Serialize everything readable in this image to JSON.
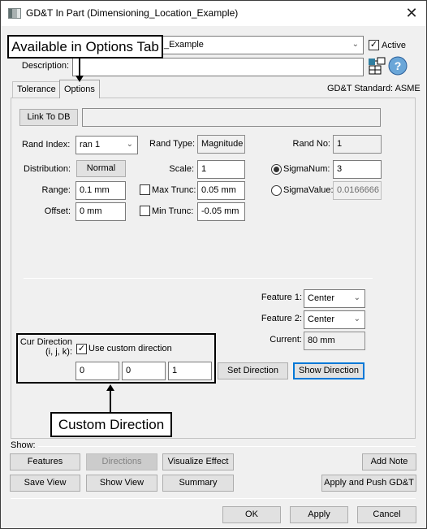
{
  "window": {
    "title": "GD&T In Part (Dimensioning_Location_Example)",
    "close_glyph": "✕"
  },
  "header": {
    "name_combo_value": "_Example",
    "active_label": "Active",
    "active_checked": true,
    "description_label": "Description:",
    "description_value": "",
    "gdt_standard": "GD&T Standard: ASME"
  },
  "tabs": [
    {
      "label": "Tolerance",
      "active": false
    },
    {
      "label": "Options",
      "active": true
    }
  ],
  "options": {
    "link_to_db_label": "Link To DB",
    "link_to_db_value": "",
    "rand_index_label": "Rand Index:",
    "rand_index_value": "ran 1",
    "rand_type_label": "Rand Type:",
    "rand_type_value": "Magnitude",
    "rand_no_label": "Rand No:",
    "rand_no_value": "1",
    "distribution_label": "Distribution:",
    "distribution_value": "Normal",
    "scale_label": "Scale:",
    "scale_value": "1",
    "sigma_num_label": "SigmaNum:",
    "sigma_num_value": "3",
    "sigma_num_selected": true,
    "range_label": "Range:",
    "range_value": "0.1 mm",
    "max_trunc_label": "Max Trunc:",
    "max_trunc_value": "0.05 mm",
    "max_trunc_checked": false,
    "sigma_value_label": "SigmaValue:",
    "sigma_value_value": "0.0166666",
    "offset_label": "Offset:",
    "offset_value": "0 mm",
    "min_trunc_label": "Min Trunc:",
    "min_trunc_value": "-0.05 mm",
    "min_trunc_checked": false,
    "feature1_label": "Feature 1:",
    "feature1_value": "Center",
    "feature2_label": "Feature 2:",
    "feature2_value": "Center",
    "current_label": "Current:",
    "current_value": "80 mm",
    "cur_direction_label_line1": "Cur Direction",
    "cur_direction_label_line2": "(i, j, k):",
    "use_custom_direction_label": "Use custom direction",
    "use_custom_direction_checked": true,
    "direction_i": "0",
    "direction_j": "0",
    "direction_k": "1",
    "set_direction_label": "Set Direction",
    "show_direction_label": "Show Direction"
  },
  "show_section": {
    "label": "Show:",
    "buttons": {
      "features": "Features",
      "directions": "Directions",
      "visualize_effect": "Visualize Effect",
      "add_note": "Add Note",
      "save_view": "Save View",
      "show_view": "Show View",
      "summary": "Summary",
      "apply_and_push": "Apply and Push GD&T"
    }
  },
  "footer": {
    "ok": "OK",
    "apply": "Apply",
    "cancel": "Cancel"
  },
  "annotations": {
    "options_tab_callout": "Available in Options Tab",
    "custom_direction_callout": "Custom Direction"
  },
  "icons": {
    "checkmark": "✓",
    "chevron_down": "⌄",
    "help": "?"
  }
}
